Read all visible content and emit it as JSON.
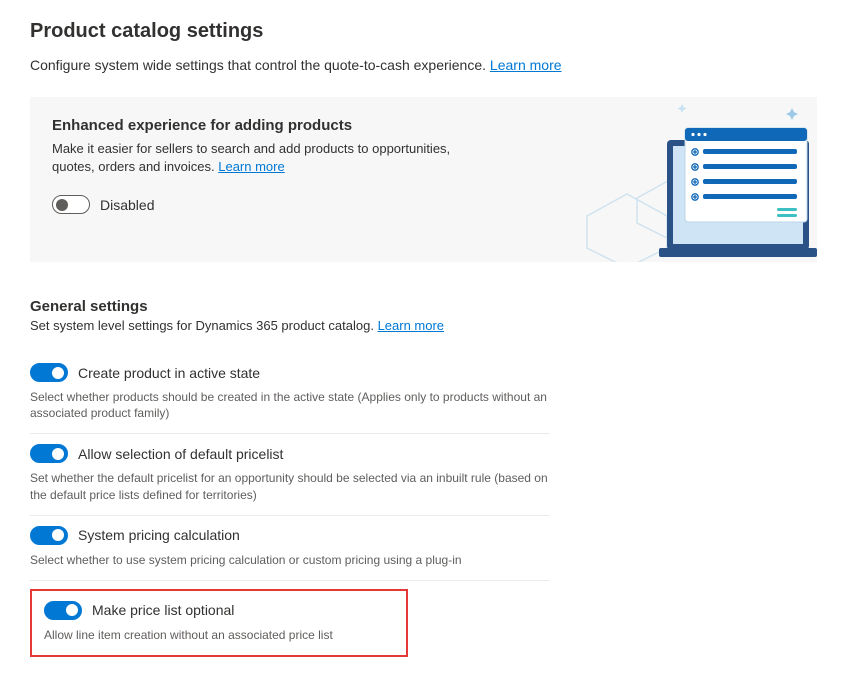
{
  "page": {
    "title": "Product catalog settings",
    "subtitle": "Configure system wide settings that control the quote-to-cash experience.",
    "learn_more": "Learn more"
  },
  "enhanced": {
    "heading": "Enhanced experience for adding products",
    "desc_prefix": "Make it easier for sellers to search and add products to opportunities, quotes, orders and invoices.",
    "learn_more": "Learn more",
    "toggle_label": "Disabled"
  },
  "general": {
    "heading": "General settings",
    "subtitle_prefix": "Set system level settings for Dynamics 365 product catalog.",
    "learn_more": "Learn more",
    "items": [
      {
        "label": "Create product in active state",
        "help": "Select whether products should be created in the active state (Applies only to products without an associated product family)"
      },
      {
        "label": "Allow selection of default pricelist",
        "help": "Set whether the default pricelist for an opportunity should be selected via an inbuilt rule (based on the default price lists defined for territories)"
      },
      {
        "label": "System pricing calculation",
        "help": "Select whether to use system pricing calculation or custom pricing using a plug-in"
      },
      {
        "label": "Make price list optional",
        "help": "Allow line item creation without an associated price list"
      }
    ]
  }
}
